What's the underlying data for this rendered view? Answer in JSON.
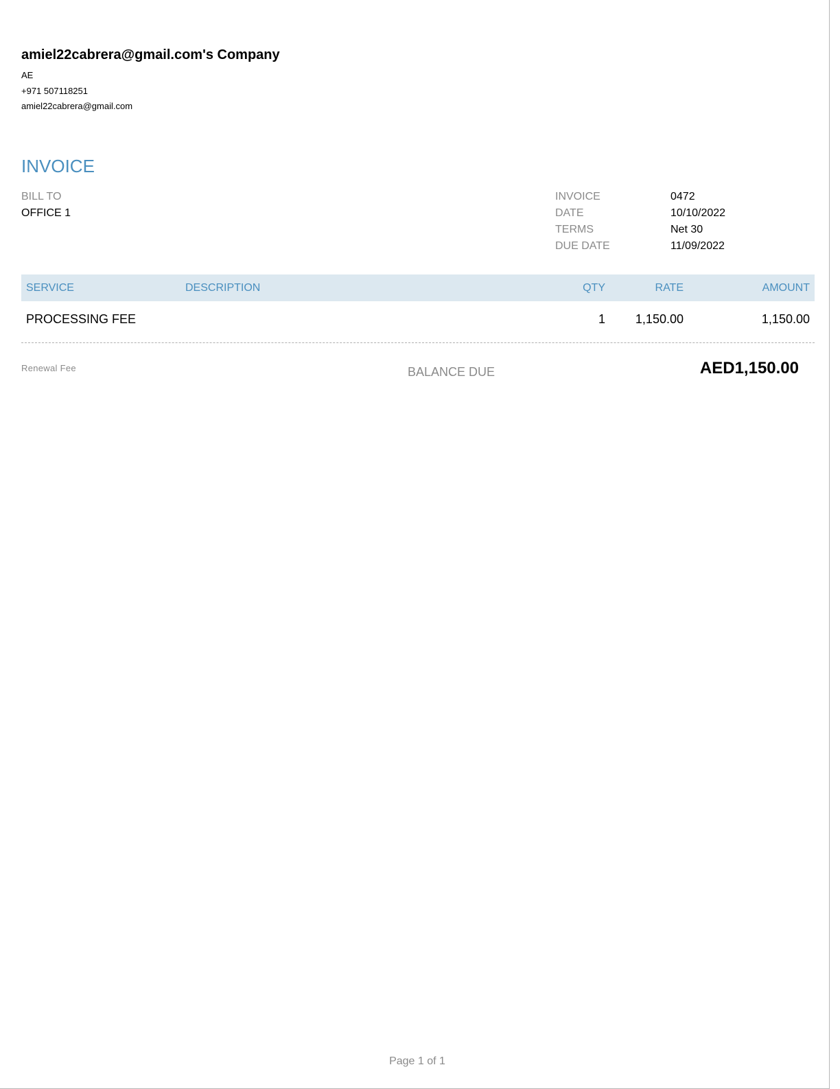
{
  "company": {
    "name": "amiel22cabrera@gmail.com's Company",
    "country": "AE",
    "phone": "+971 507118251",
    "email": "amiel22cabrera@gmail.com"
  },
  "document": {
    "title": "INVOICE"
  },
  "bill_to": {
    "label": "BILL TO",
    "value": "OFFICE 1"
  },
  "meta": [
    {
      "label": "INVOICE",
      "value": "0472"
    },
    {
      "label": "DATE",
      "value": "10/10/2022"
    },
    {
      "label": "TERMS",
      "value": "Net 30"
    },
    {
      "label": "DUE DATE",
      "value": "11/09/2022"
    }
  ],
  "items_table": {
    "headers": {
      "service": "SERVICE",
      "description": "DESCRIPTION",
      "qty": "QTY",
      "rate": "RATE",
      "amount": "AMOUNT"
    },
    "rows": [
      {
        "service": "PROCESSING FEE",
        "description": "",
        "qty": "1",
        "rate": "1,150.00",
        "amount": "1,150.00"
      }
    ]
  },
  "summary": {
    "note": "Renewal Fee",
    "balance_label": "BALANCE DUE",
    "balance_amount": "AED1,150.00"
  },
  "footer": {
    "page": "Page 1 of 1"
  },
  "colors": {
    "accent": "#4a8fbf",
    "header_bg": "#dce8f0",
    "muted": "#8a8a8a"
  }
}
